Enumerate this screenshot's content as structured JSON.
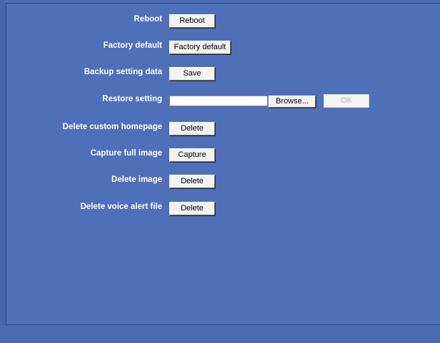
{
  "rows": [
    {
      "label": "Reboot",
      "button": "Reboot"
    },
    {
      "label": "Factory default",
      "button": "Factory default"
    },
    {
      "label": "Backup setting data",
      "button": "Save"
    },
    {
      "label": "Restore setting",
      "file_value": "",
      "browse": "Browse...",
      "ok": "OK",
      "ok_disabled": true
    },
    {
      "label": "Delete custom homepage",
      "button": "Delete"
    },
    {
      "label": "Capture full image",
      "button": "Capture"
    },
    {
      "label": "Delete image",
      "button": "Delete"
    },
    {
      "label": "Delete voice alert file",
      "button": "Delete"
    }
  ],
  "colors": {
    "background": "#4f70b8",
    "label_text": "#ffffff",
    "button_face": "#f2f2f0",
    "disabled_text": "#b0b0b0"
  }
}
